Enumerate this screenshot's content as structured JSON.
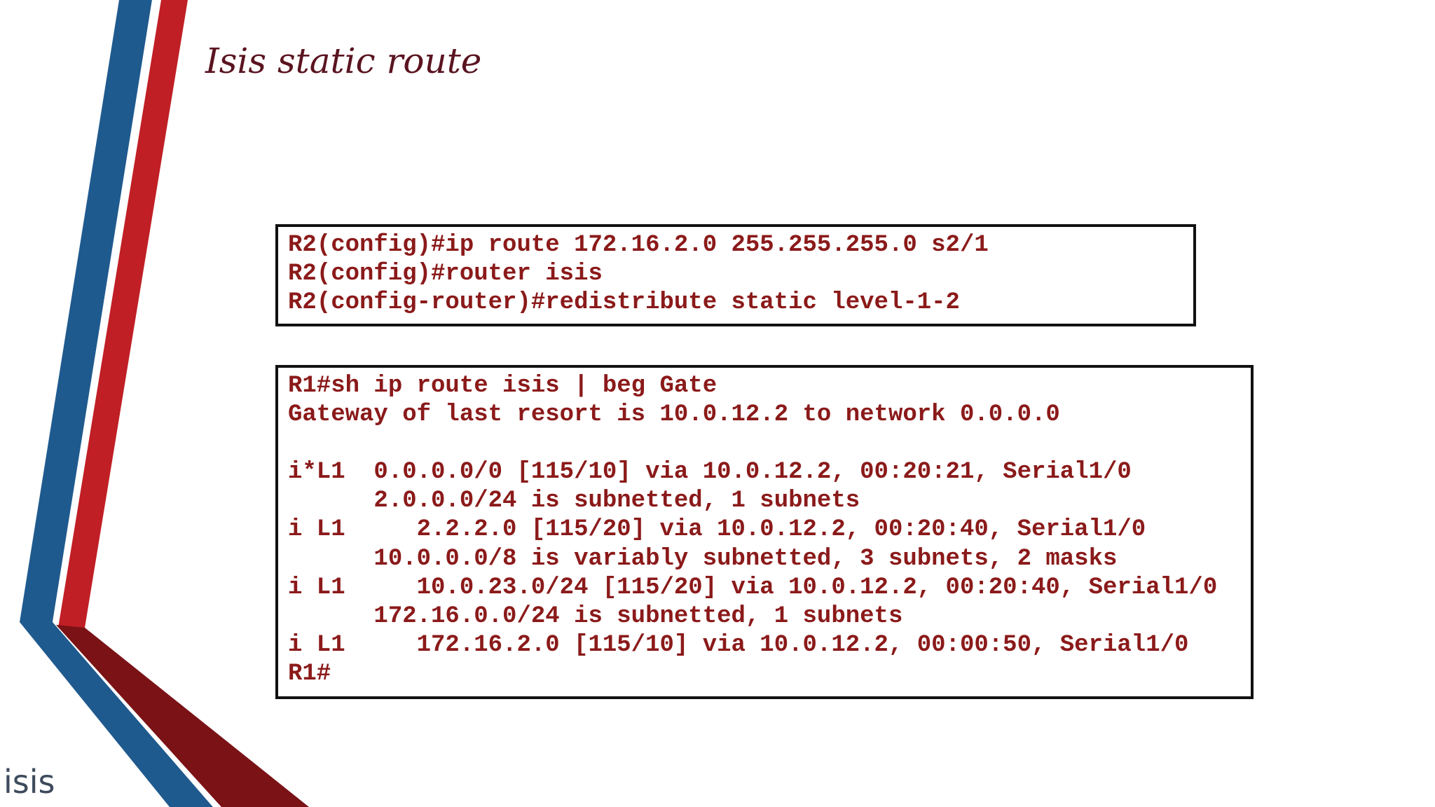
{
  "slide": {
    "title": "Isis static route",
    "footer_label": "isis",
    "colors": {
      "title": "#5a1420",
      "code_text": "#8b1a1a",
      "box_border": "#111111",
      "stripe_blue": "#1f5a8e",
      "stripe_red": "#c01f25",
      "stripe_dark_red": "#7a1216",
      "footer_text": "#3d4b5c"
    }
  },
  "config_box": {
    "lines": [
      "R2(config)#ip route 172.16.2.0 255.255.255.0 s2/1",
      "R2(config)#router isis",
      "R2(config-router)#redistribute static level-1-2"
    ]
  },
  "output_box": {
    "lines": [
      "R1#sh ip route isis | beg Gate",
      "Gateway of last resort is 10.0.12.2 to network 0.0.0.0",
      "",
      "i*L1  0.0.0.0/0 [115/10] via 10.0.12.2, 00:20:21, Serial1/0",
      "      2.0.0.0/24 is subnetted, 1 subnets",
      "i L1     2.2.2.0 [115/20] via 10.0.12.2, 00:20:40, Serial1/0",
      "      10.0.0.0/8 is variably subnetted, 3 subnets, 2 masks",
      "i L1     10.0.23.0/24 [115/20] via 10.0.12.2, 00:20:40, Serial1/0",
      "      172.16.0.0/24 is subnetted, 1 subnets",
      "i L1     172.16.2.0 [115/10] via 10.0.12.2, 00:00:50, Serial1/0",
      "R1#"
    ]
  }
}
